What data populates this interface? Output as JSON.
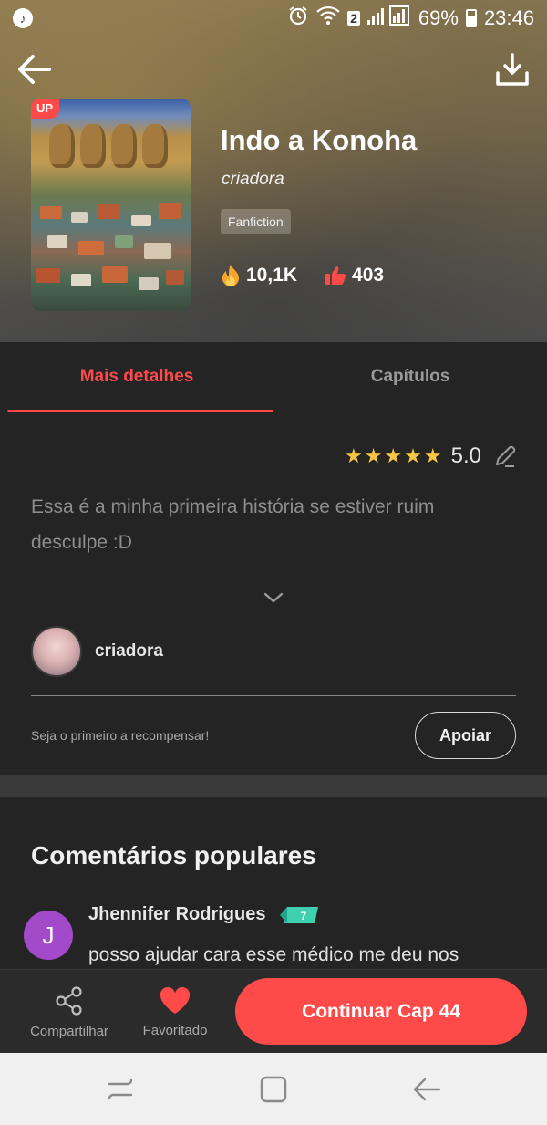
{
  "status_bar": {
    "battery": "69%",
    "time": "23:46",
    "sim_badge": "2"
  },
  "story": {
    "badge": "UP",
    "title": "Indo a Konoha",
    "author": "criadora",
    "tag": "Fanfiction",
    "views": "10,1K",
    "likes": "403"
  },
  "tabs": [
    {
      "label": "Mais detalhes",
      "active": true
    },
    {
      "label": "Capítulos",
      "active": false
    }
  ],
  "details": {
    "rating": "5.0",
    "stars": 5,
    "description": "Essa é a minha primeira história se estiver ruim desculpe :D",
    "creator_name": "criadora",
    "reward_text": "Seja o primeiro a recompensar!",
    "support_label": "Apoiar"
  },
  "comments": {
    "title": "Comentários populares",
    "items": [
      {
        "initial": "J",
        "user": "Jhennifer Rodrigues",
        "level": "7",
        "text": "posso ajudar cara esse médico me deu nos"
      }
    ]
  },
  "bottom_bar": {
    "share_label": "Compartilhar",
    "favorite_label": "Favoritado",
    "continue_label": "Continuar Cap 44"
  },
  "colors": {
    "accent": "#ff4a4a",
    "background": "#242424",
    "star": "#f5c543",
    "comment_avatar": "#a24ac9"
  },
  "icons": [
    "music-icon",
    "alarm-icon",
    "wifi-icon",
    "signal-icon",
    "battery-icon",
    "back-arrow-icon",
    "download-icon",
    "fire-icon",
    "thumbs-up-icon",
    "star-icon",
    "edit-pencil-icon",
    "chevron-down-icon",
    "level-badge-icon",
    "share-icon",
    "heart-icon",
    "recent-apps-icon",
    "home-icon",
    "nav-back-icon"
  ]
}
